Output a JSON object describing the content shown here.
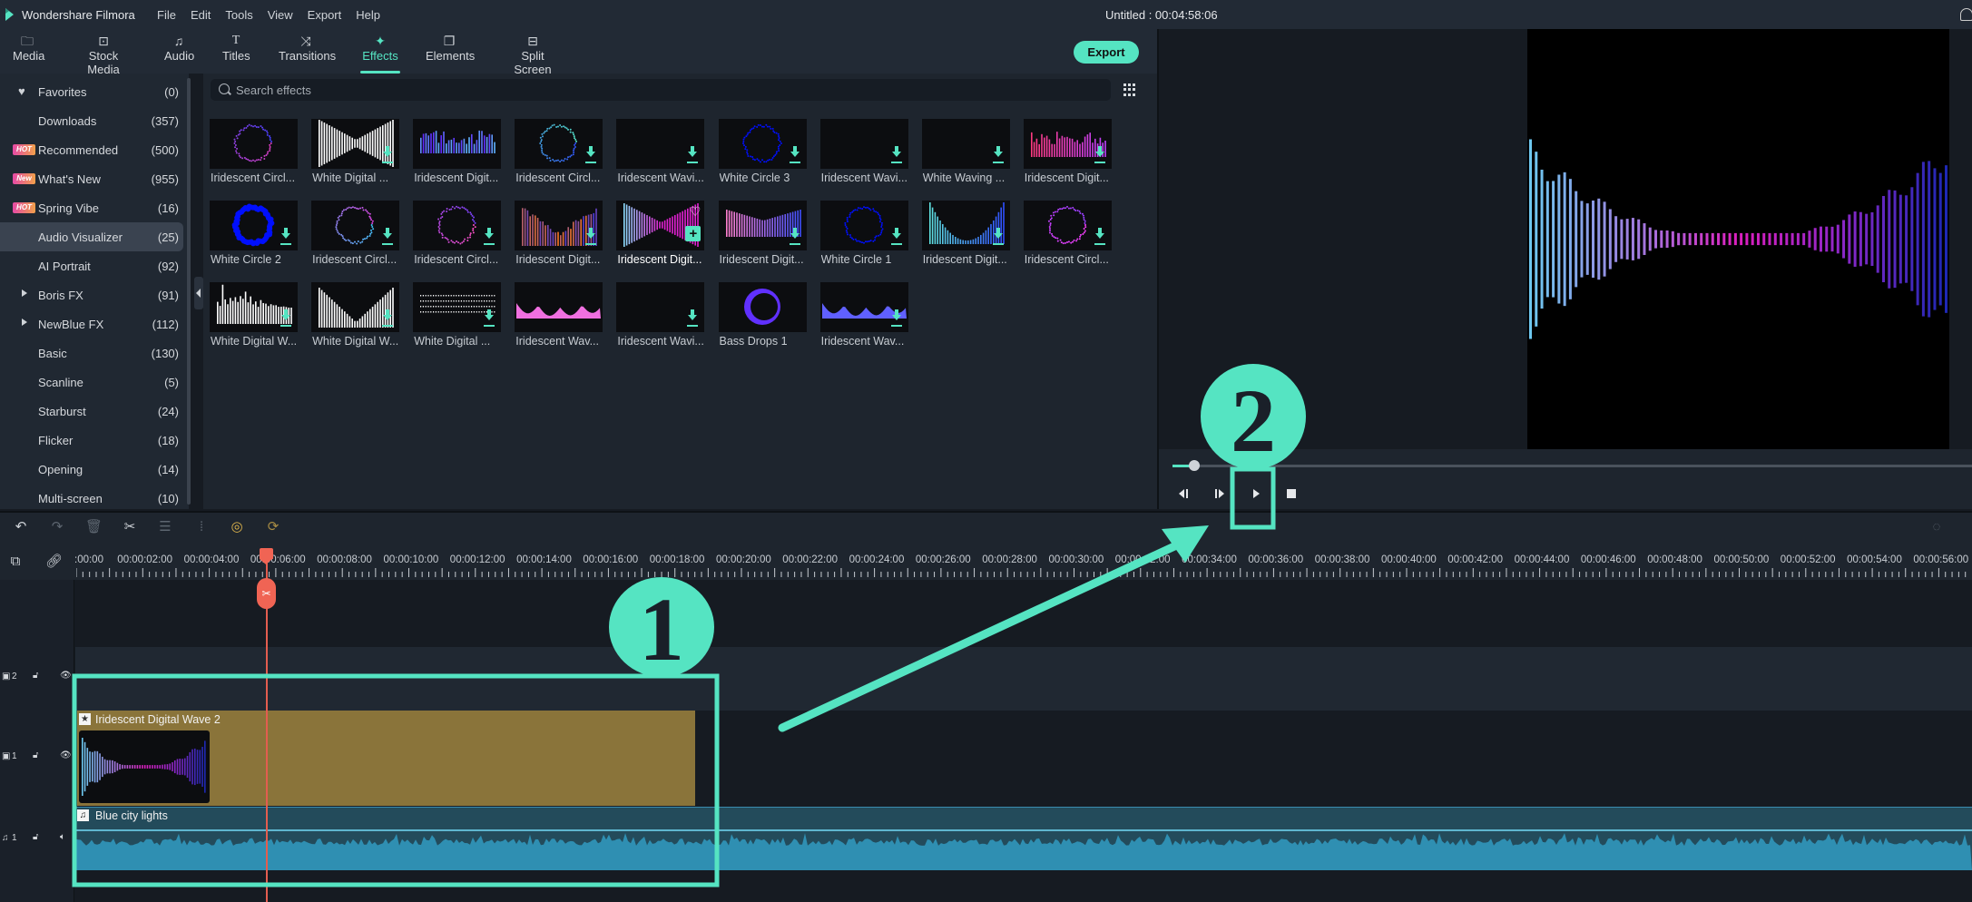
{
  "app": {
    "name": "Wondershare Filmora",
    "menu": [
      "File",
      "Edit",
      "Tools",
      "View",
      "Export",
      "Help"
    ],
    "project_title": "Untitled : 00:04:58:06"
  },
  "toolbar": {
    "tabs": [
      {
        "label": "Media",
        "icon": "folder-icon"
      },
      {
        "label": "Stock Media",
        "icon": "stock-media-icon"
      },
      {
        "label": "Audio",
        "icon": "music-note-icon"
      },
      {
        "label": "Titles",
        "icon": "text-t-icon"
      },
      {
        "label": "Transitions",
        "icon": "transitions-icon"
      },
      {
        "label": "Effects",
        "icon": "effects-icon",
        "active": true
      },
      {
        "label": "Elements",
        "icon": "elements-icon"
      },
      {
        "label": "Split Screen",
        "icon": "split-screen-icon"
      }
    ],
    "export_label": "Export"
  },
  "sidebar": {
    "items": [
      {
        "label": "Favorites",
        "count": "(0)",
        "icon": "heart-icon"
      },
      {
        "label": "Downloads",
        "count": "(357)"
      },
      {
        "label": "Recommended",
        "count": "(500)",
        "badge": "HOT"
      },
      {
        "label": "What's New",
        "count": "(955)",
        "badge": "New"
      },
      {
        "label": "Spring Vibe",
        "count": "(16)",
        "badge": "HOT"
      },
      {
        "label": "Audio Visualizer",
        "count": "(25)",
        "selected": true
      },
      {
        "label": "AI Portrait",
        "count": "(92)"
      },
      {
        "label": "Boris FX",
        "count": "(91)",
        "expandable": true
      },
      {
        "label": "NewBlue FX",
        "count": "(112)",
        "expandable": true
      },
      {
        "label": "Basic",
        "count": "(130)"
      },
      {
        "label": "Scanline",
        "count": "(5)"
      },
      {
        "label": "Starburst",
        "count": "(24)"
      },
      {
        "label": "Flicker",
        "count": "(18)"
      },
      {
        "label": "Opening",
        "count": "(14)"
      },
      {
        "label": "Multi-screen",
        "count": "(10)"
      }
    ]
  },
  "search": {
    "placeholder": "Search effects",
    "value": ""
  },
  "effects": [
    {
      "name": "Iridescent Circl...",
      "style": "circle-irid",
      "download": false
    },
    {
      "name": "White  Digital ...",
      "style": "bars-white-v",
      "download": true
    },
    {
      "name": "Iridescent Digit...",
      "style": "bars-blue",
      "download": false
    },
    {
      "name": "Iridescent Circl...",
      "style": "circle-blue",
      "download": true
    },
    {
      "name": "Iridescent Wavi...",
      "style": "line-v",
      "download": true
    },
    {
      "name": "White Circle 3",
      "style": "circle-white",
      "download": true
    },
    {
      "name": "Iridescent Wavi...",
      "style": "line-peak",
      "download": true
    },
    {
      "name": "White Waving ...",
      "style": "line-white",
      "download": true
    },
    {
      "name": "Iridescent Digit...",
      "style": "bars-pink",
      "download": true
    },
    {
      "name": "White Circle 2",
      "style": "circle-white-blob",
      "download": true
    },
    {
      "name": "Iridescent Circl...",
      "style": "circle-cyan",
      "download": true
    },
    {
      "name": "Iridescent Circl...",
      "style": "circle-pink",
      "download": true
    },
    {
      "name": "Iridescent Digit...",
      "style": "bars-rainbow",
      "download": true
    },
    {
      "name": "Iridescent Digit...",
      "style": "bars-mirror",
      "download": false,
      "hover": true
    },
    {
      "name": "Iridescent Digit...",
      "style": "bars-purple",
      "download": true
    },
    {
      "name": "White Circle 1",
      "style": "circle-white",
      "download": true
    },
    {
      "name": "Iridescent Digit...",
      "style": "bars-cyan-u",
      "download": true
    },
    {
      "name": "Iridescent Circl...",
      "style": "circle-magenta",
      "download": true
    },
    {
      "name": "White Digital W...",
      "style": "bars-white",
      "download": true
    },
    {
      "name": "White Digital W...",
      "style": "bars-white-u",
      "download": true
    },
    {
      "name": "White  Digital ...",
      "style": "dots-white",
      "download": true
    },
    {
      "name": "Iridescent Wav...",
      "style": "area-pink",
      "download": false
    },
    {
      "name": "Iridescent Wavi...",
      "style": "line-wavy",
      "download": true
    },
    {
      "name": "Bass Drops 1",
      "style": "bass-drop",
      "download": false
    },
    {
      "name": "Iridescent Wav...",
      "style": "area-rainbow",
      "download": true
    }
  ],
  "preview": {
    "progress": 0.02
  },
  "timeline": {
    "ruler_labels": [
      ":00:00",
      "00:00:02:00",
      "00:00:04:00",
      "00:00:06:00",
      "00:00:08:00",
      "00:00:10:00",
      "00:00:12:00",
      "00:00:14:00",
      "00:00:16:00",
      "00:00:18:00",
      "00:00:20:00",
      "00:00:22:00",
      "00:00:24:00",
      "00:00:26:00",
      "00:00:28:00",
      "00:00:30:00",
      "00:00:32:00",
      "00:00:34:00",
      "00:00:36:00",
      "00:00:38:00",
      "00:00:40:00",
      "00:00:42:00",
      "00:00:44:00",
      "00:00:46:00",
      "00:00:48:00",
      "00:00:50:00",
      "00:00:52:00",
      "00:00:54:00",
      "00:00:56:00"
    ],
    "tracks": [
      {
        "label": "2",
        "type": "video"
      },
      {
        "label": "1",
        "type": "video"
      },
      {
        "label": "1",
        "type": "audio"
      }
    ],
    "video_clip_title": "Iridescent Digital Wave 2",
    "audio_clip_title": "Blue city lights"
  },
  "annotations": {
    "step1": "1",
    "step2": "2",
    "color": "#55e4c2"
  },
  "colors": {
    "accent": "#55e4c2",
    "playhead": "#f06454",
    "video_clip": "#8a743a",
    "audio_clip": "#234b5b"
  }
}
